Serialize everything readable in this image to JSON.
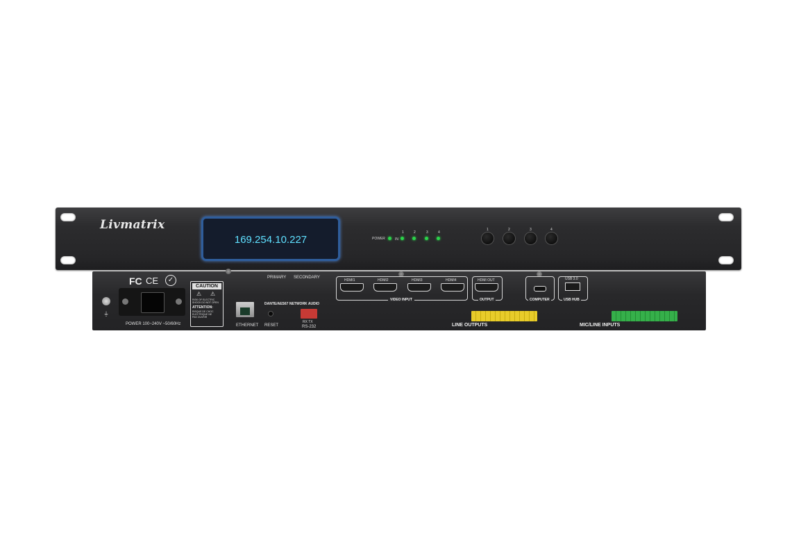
{
  "front": {
    "brand": "Livmatrix",
    "display_ip": "169.254.10.227",
    "power_label": "POWER",
    "in_label": "IN",
    "led_numbers": [
      "1",
      "2",
      "3",
      "4"
    ],
    "button_numbers": [
      "1",
      "2",
      "3",
      "4"
    ],
    "led_color": "#2bd44a",
    "display_text_color": "#5fe0ff"
  },
  "rear": {
    "certs": {
      "fc": "FC",
      "ce": "CE"
    },
    "power_label": "POWER 100~240V ~50/60Hz",
    "caution_title": "CAUTION",
    "caution_lines": [
      "RISK OF ELECTRIC",
      "SHOCK DO NOT OPEN"
    ],
    "attention_title": "ATTENTION:",
    "attention_lines": [
      "RISQUE DE CHOC",
      "ELECTRIQUE NE",
      "PAS OUVRIR"
    ],
    "ethernet_label": "ETHERNET",
    "primary_label": "PRIMARY",
    "secondary_label": "SECONDARY",
    "dante_label": "DANTE/AES67 NETWORK AUDIO",
    "reset_label": "RESET",
    "rs232_pins": "RX TX",
    "rs232_label": "RS-232",
    "hdmi_inputs": [
      "HDMI1",
      "HDMI2",
      "HDMI3",
      "HDMI4"
    ],
    "video_input_label": "VIDEO INPUT",
    "hdmi_out": "HDMI OUT",
    "output_label": "OUTPUT",
    "computer_label": "COMPUTER",
    "usb_label": "USB 3.0",
    "usb_hub_label": "USB HUB",
    "line_outputs_label": "LINE OUTPUTS",
    "mic_line_inputs_label": "MIC/LINE INPUTS",
    "terminal_yellow": "#e8cc2a",
    "terminal_green": "#35b04a"
  }
}
